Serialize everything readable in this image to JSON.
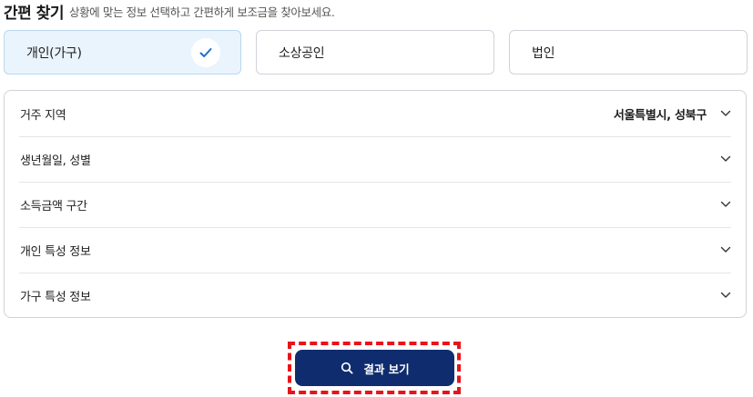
{
  "header": {
    "title": "간편 찾기",
    "subtitle": "상황에 맞는 정보 선택하고 간편하게 보조금을 찾아보세요."
  },
  "applicant_types": [
    {
      "label": "개인(가구)",
      "selected": true
    },
    {
      "label": "소상공인",
      "selected": false
    },
    {
      "label": "법인",
      "selected": false
    }
  ],
  "filters": [
    {
      "label": "거주 지역",
      "value": "서울특별시, 성북구"
    },
    {
      "label": "생년월일, 성별",
      "value": ""
    },
    {
      "label": "소득금액 구간",
      "value": ""
    },
    {
      "label": "개인 특성 정보",
      "value": ""
    },
    {
      "label": "가구 특성 정보",
      "value": ""
    }
  ],
  "result_button": {
    "label": "결과 보기",
    "icon": "search-icon"
  },
  "colors": {
    "selected_card_bg": "#eaf4fd",
    "check_mark": "#1a6fd6",
    "primary_button": "#0f2d6e",
    "highlight_border": "#e8141a"
  }
}
